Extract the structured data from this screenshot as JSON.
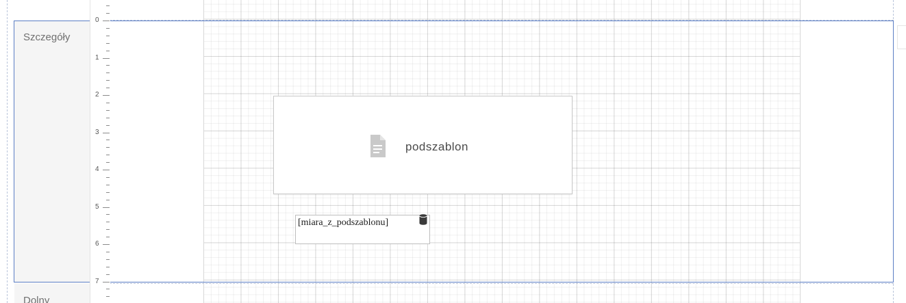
{
  "bands": {
    "details_label": "Szczegóły",
    "footer_label": "Dolny"
  },
  "ruler": {
    "numbers": [
      "0",
      "1",
      "2",
      "3",
      "4",
      "5",
      "6",
      "7"
    ]
  },
  "canvas": {
    "subreport": {
      "label": "podszablon",
      "icon": "document-icon"
    },
    "field": {
      "expression": "[miara_z_podszablonu]",
      "icon": "database-icon"
    }
  },
  "colors": {
    "band_border": "#5a7dc4",
    "guide_dashed": "#b9c4da",
    "label_background": "#f5f5f5",
    "icon_gray": "#c9c9c9",
    "db_icon": "#3a3a3a"
  }
}
